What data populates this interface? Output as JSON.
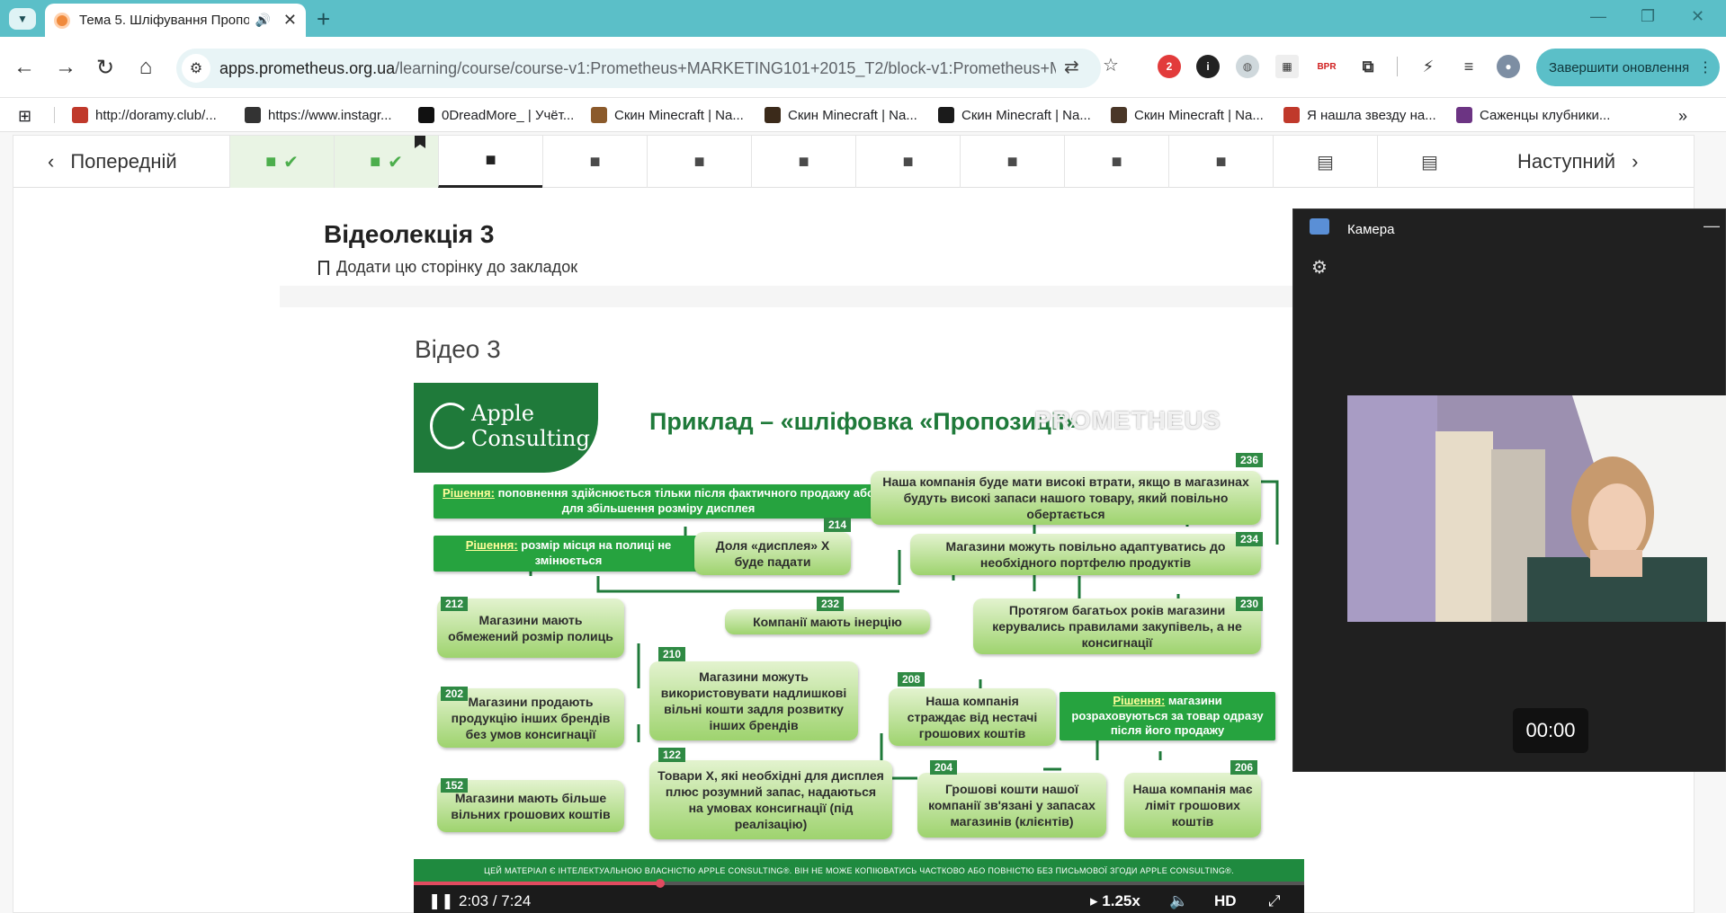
{
  "browser": {
    "tab_title": "Тема 5. Шліфування Пропо",
    "url_host": "apps.prometheus.org.ua",
    "url_path": "/learning/course/course-v1:Prometheus+MARKETING101+2015_T2/block-v1:Prometheus+MA...",
    "update_button": "Завершити оновлення",
    "extension_badge": "2",
    "extension_bpr": "BPR"
  },
  "bookmarks": [
    {
      "label": "http://doramy.club/...",
      "color": "#c0392b"
    },
    {
      "label": "https://www.instagr...",
      "color": "#333333"
    },
    {
      "label": "0DreadMore_ | Учёт...",
      "color": "#111111"
    },
    {
      "label": "Скин Minecraft | Na...",
      "color": "#8b5a2b"
    },
    {
      "label": "Скин Minecraft | Na...",
      "color": "#3b2a1a"
    },
    {
      "label": "Скин Minecraft | Na...",
      "color": "#1b1b1b"
    },
    {
      "label": "Скин Minecraft | Na...",
      "color": "#4a3728"
    },
    {
      "label": "Я нашла звезду на...",
      "color": "#c0392b"
    },
    {
      "label": "Саженцы клубники...",
      "color": "#6c3483"
    }
  ],
  "course_nav": {
    "prev_label": "Попередній",
    "next_label": "Наступний"
  },
  "unit": {
    "title": "Відеолекція 3",
    "bookmark_label": "Додати цю сторінку до закладок",
    "video_title": "Відео 3"
  },
  "slide": {
    "logo_line1": "Apple",
    "logo_line2": "Consulting",
    "title": "Приклад – «шліфовка «Пропозиції» ",
    "watermark": "PROMETHEUS",
    "solution_word": "Рішення:",
    "solution1": " поповнення здійснюється тільки після фактичного продажу або для збільшення розміру дисплея",
    "solution2": " розмір місця на полиці не змінюється",
    "solution3": " магазини розраховуються за товар одразу після його продажу",
    "box_236": "Наша компанія буде мати високі втрати, якщо в магазинах будуть високі запаси нашого товару, який повільно обертається",
    "box_214": "Доля «дисплея» Х буде падати",
    "box_234": "Магазини можуть повільно адаптуватись до необхідного портфелю продуктів",
    "box_232": "Компанії мають інерцію",
    "box_230": "Протягом багатьох років магазини керувались правилами закупівель, а не консигнації",
    "box_212": "Магазини мають обмежений розмір полиць",
    "box_210": "Магазини можуть використовувати надлишкові вільні кошти задля розвитку інших брендів",
    "box_208": "Наша компанія страждає від нестачі грошових коштів",
    "box_202": "Магазини продають продукцію інших брендів без умов консигнації",
    "box_122": "Товари Х, які необхідні для дисплея плюс розумний запас, надаються на умовах консигнації (під реалізацію)",
    "box_204": "Грошові кошти нашої компанії зв'язані у запасах магазинів (клієнтів)",
    "box_206": "Наша компанія має ліміт грошових коштів",
    "box_152": "Магазини мають більше вільних грошових коштів",
    "tags": [
      "236",
      "214",
      "234",
      "232",
      "230",
      "212",
      "210",
      "208",
      "202",
      "122",
      "204",
      "206",
      "152"
    ],
    "footer": "ЦЕЙ МАТЕРІАЛ Є ІНТЕЛЕКТУАЛЬНОЮ ВЛАСНІСТЮ APPLE CONSULTING®. ВІН НЕ МОЖЕ КОПІЮВАТИСЬ ЧАСТКОВО АБО ПОВНІСТЮ БЕЗ ПИСЬМОВОЇ ЗГОДИ APPLE CONSULTING®."
  },
  "player": {
    "time": "2:03 / 7:24",
    "progress_fraction": 0.277,
    "speed": "1.25x",
    "quality": "HD"
  },
  "camera": {
    "title": "Камера",
    "timer": "00:00"
  },
  "colors": {
    "chrome_accent": "#5bbfc8",
    "completed_bg": "#e9f4e4",
    "completed_icon": "#4cae4c",
    "slide_green": "#1f7a3a",
    "progress": "#e14b60"
  }
}
